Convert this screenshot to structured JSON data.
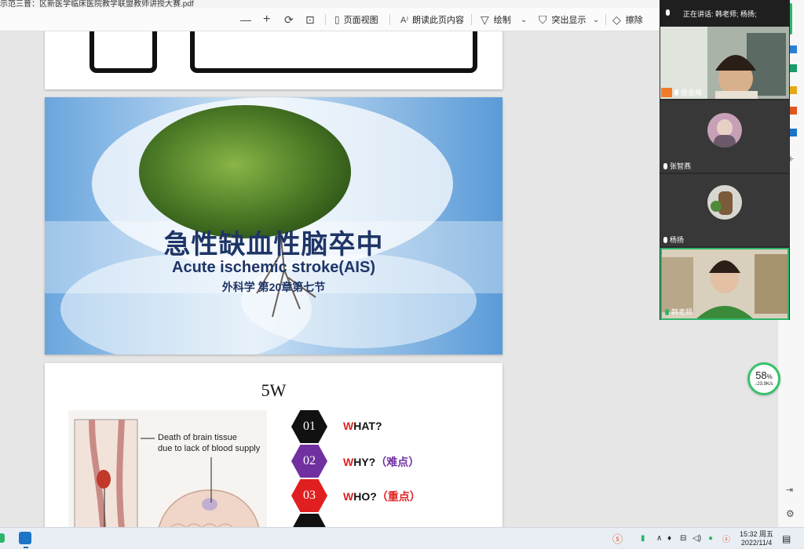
{
  "window": {
    "title": "示范三普：区新医学临床医院教学联盟教师讲授大赛.pdf"
  },
  "toolbar": {
    "minus": "—",
    "plus": "+",
    "page_view": "页面视图",
    "read_aloud": "朗读此页内容",
    "draw": "绘制",
    "highlight": "突出显示",
    "erase": "擦除"
  },
  "slides": {
    "cover": {
      "title_cn": "急性缺血性脑卒中",
      "title_en": "Acute ischemic stroke(AIS)",
      "subtitle": "外科学 第20章第七节"
    },
    "fivew": {
      "title": "5W",
      "caption_line1": "Death of brain tissue",
      "caption_line2": "due to lack of blood supply",
      "items": [
        {
          "num": "01",
          "first": "W",
          "rest": "HAT?",
          "extra": "",
          "color": "#111111"
        },
        {
          "num": "02",
          "first": "W",
          "rest": "HY?",
          "extra": "（难点）",
          "color": "#7030a0"
        },
        {
          "num": "03",
          "first": "W",
          "rest": "HO?",
          "extra": "（重点）",
          "color": "#e02020"
        }
      ]
    }
  },
  "meeting": {
    "speaking": "正在讲话: 韩老师; 杨扬;",
    "participants": [
      {
        "name": "徐金梅"
      },
      {
        "name": "张智燕"
      },
      {
        "name": "杨扬"
      },
      {
        "name": "韩老师"
      }
    ]
  },
  "net_widget": {
    "percent": "58",
    "unit": "%",
    "speed": "↓23.9K/s"
  },
  "taskbar": {
    "time": "15:32 周五",
    "date": "2022/11/4"
  }
}
